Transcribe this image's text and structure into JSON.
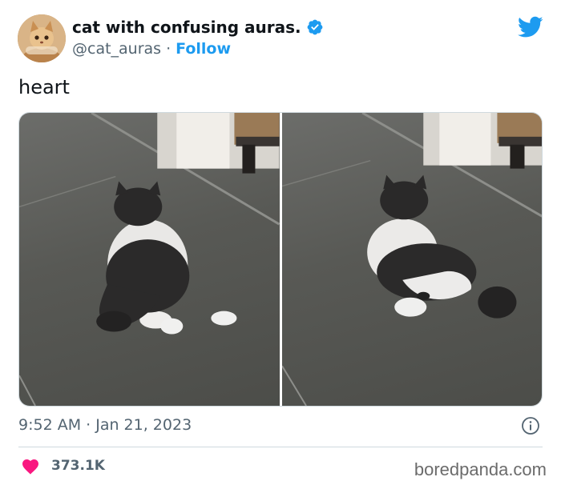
{
  "author": {
    "display_name": "cat with confusing auras.",
    "handle": "@cat_auras",
    "separator": "·",
    "follow_label": "Follow",
    "verified": true
  },
  "tweet": {
    "text": "heart",
    "timestamp": "9:52 AM · Jan 21, 2023",
    "likes": "373.1K"
  },
  "watermark": "boredpanda.com",
  "colors": {
    "brand": "#1d9bf0",
    "heart": "#f91880",
    "muted_text": "#536471",
    "text": "#0f1419"
  },
  "icons": [
    "verified-badge-icon",
    "twitter-bird-icon",
    "info-icon",
    "heart-icon"
  ]
}
